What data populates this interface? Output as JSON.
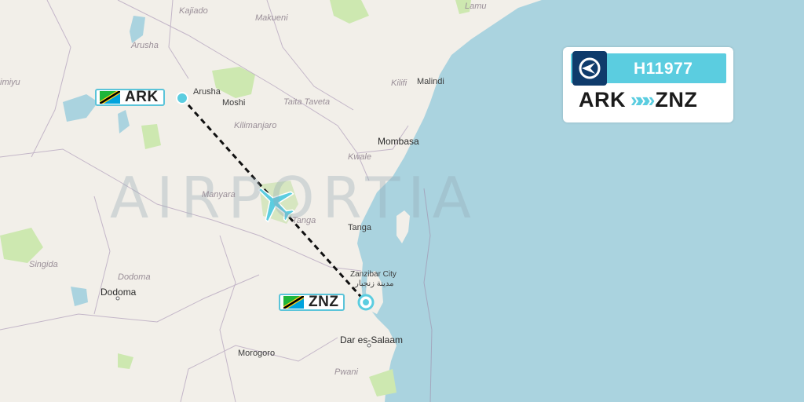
{
  "flight": {
    "number": "H11977",
    "origin": "ARK",
    "destination": "ZNZ",
    "chevrons": "»»»",
    "accent_color": "#5bcde0",
    "logo_color": "#0f3b6b"
  },
  "markers": {
    "origin_label": "ARK",
    "destination_label": "ZNZ",
    "flag": "tanzania-flag-icon"
  },
  "watermark": "AIRPORTIA",
  "regions": [
    "Kajiado",
    "Makueni",
    "Arusha",
    "Kilimanjaro",
    "Taita Taveta",
    "Kilifi",
    "Kwale",
    "Manyara",
    "Tanga",
    "Singida",
    "Dodoma",
    "Morogoro",
    "Pwani",
    "imiyu"
  ],
  "cities": [
    "Arusha",
    "Moshi",
    "Malindi",
    "Mombasa",
    "Tanga",
    "Dodoma",
    "Zanzibar City",
    "مدينة زنجبار",
    "Dar es-Salaam",
    "Morogoro",
    "Lamu"
  ],
  "colors": {
    "sea": "#aad3df",
    "land": "#f2efe9",
    "park": "#cde8b0",
    "lake": "#aad3df",
    "route": "#111111"
  }
}
